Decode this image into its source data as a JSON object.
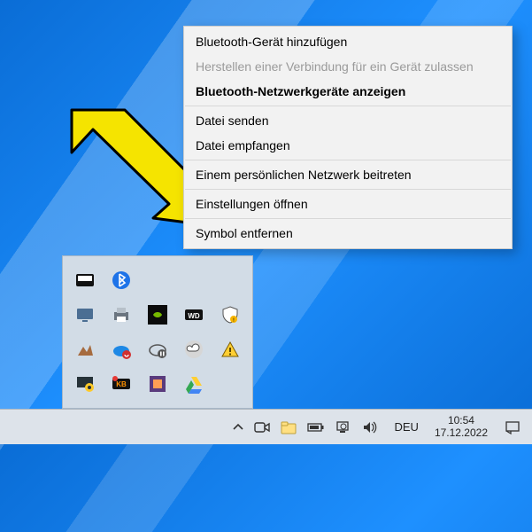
{
  "context_menu": {
    "items": [
      {
        "label": "Bluetooth-Gerät hinzufügen",
        "disabled": false,
        "bold": false
      },
      {
        "label": "Herstellen einer Verbindung für ein Gerät zulassen",
        "disabled": true,
        "bold": false
      },
      {
        "label": "Bluetooth-Netzwerkgeräte anzeigen",
        "disabled": false,
        "bold": true
      }
    ],
    "items2": [
      {
        "label": "Datei senden",
        "disabled": false
      },
      {
        "label": "Datei empfangen",
        "disabled": false
      }
    ],
    "items3": [
      {
        "label": "Einem persönlichen Netzwerk beitreten",
        "disabled": false
      }
    ],
    "items4": [
      {
        "label": "Einstellungen öffnen",
        "disabled": false
      }
    ],
    "items5": [
      {
        "label": "Symbol entfernen",
        "disabled": false
      }
    ]
  },
  "tray_flyout": {
    "icons": [
      "keyboard-indicator-icon",
      "bluetooth-icon",
      "blank",
      "blank",
      "blank",
      "display-settings-icon",
      "printer-icon",
      "nvidia-icon",
      "wd-drive-icon",
      "security-shield-icon",
      "elevation-icon",
      "onedrive-sync-icon",
      "cloud-pause-icon",
      "creative-cloud-icon",
      "warning-triangle-icon",
      "camera-overlay-icon",
      "recorder-kb-icon",
      "color-square-icon",
      "google-drive-icon",
      "blank"
    ]
  },
  "taskbar": {
    "language": "DEU",
    "time": "10:54",
    "date": "17.12.2022"
  },
  "annotation": {
    "arrow_color": "#f5e400"
  }
}
